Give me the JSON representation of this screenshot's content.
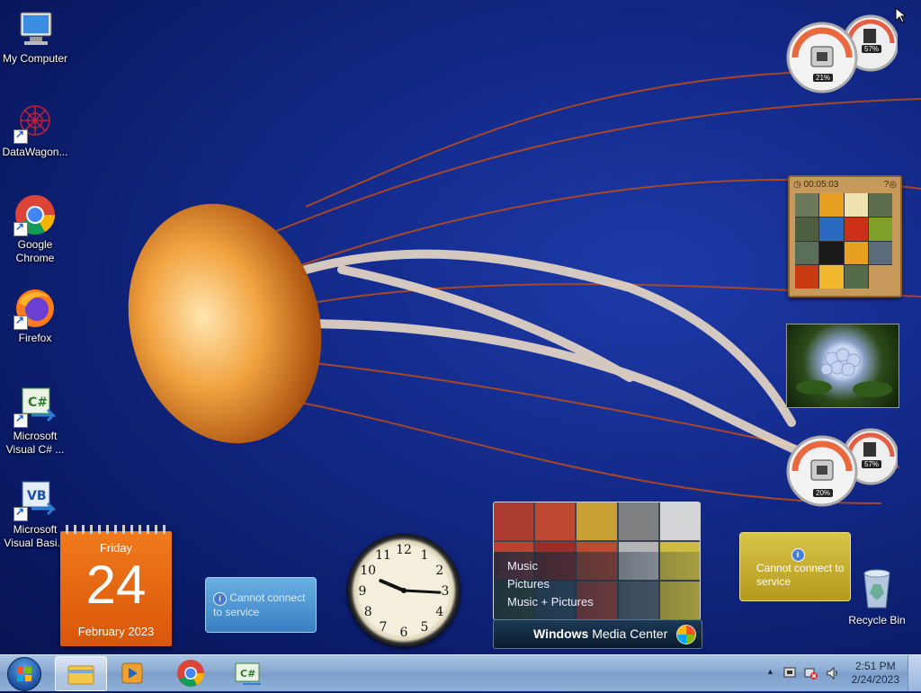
{
  "desktop_icons": [
    {
      "label": "My Computer",
      "icon": "computer-icon"
    },
    {
      "label": "DataWagon...",
      "icon": "datawagon-icon"
    },
    {
      "label": "Google Chrome",
      "icon": "chrome-icon"
    },
    {
      "label": "Firefox",
      "icon": "firefox-icon"
    },
    {
      "label": "Microsoft Visual C# ...",
      "icon": "visual-csharp-icon"
    },
    {
      "label": "Microsoft Visual Basi...",
      "icon": "visual-basic-icon"
    }
  ],
  "calendar": {
    "weekday": "Friday",
    "day": "24",
    "month_year": "February 2023"
  },
  "feed_gadget": {
    "message": "Cannot connect to service"
  },
  "weather_gadget": {
    "message": "Cannot connect to service"
  },
  "media_center": {
    "items": [
      "Music",
      "Pictures",
      "Music + Pictures"
    ],
    "title_bold": "Windows",
    "title_rest": " Media Center"
  },
  "cpu_gauge_1": {
    "cpu": "21%",
    "mem": "57%"
  },
  "cpu_gauge_2": {
    "cpu": "20%",
    "mem": "57%"
  },
  "puzzle": {
    "timer": "00:05:03"
  },
  "recycle_bin": {
    "label": "Recycle Bin"
  },
  "clock": {
    "hour_hand_deg": 293,
    "minute_hand_deg": 93
  },
  "taskbar": {
    "pinned": [
      "explorer-icon",
      "media-player-icon",
      "chrome-icon",
      "visual-csharp-icon"
    ],
    "time": "2:51 PM",
    "date": "2/24/2023"
  },
  "colors": {
    "desktop_bg": "#142b8c",
    "calendar": "#e8650f",
    "taskbar": "#8aa9d0"
  }
}
